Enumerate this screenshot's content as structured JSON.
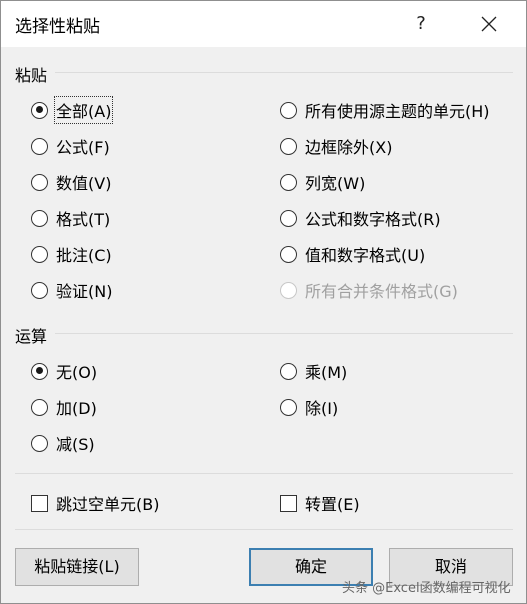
{
  "window": {
    "title": "选择性粘贴",
    "help_label": "?",
    "close_icon": "close-icon"
  },
  "paste": {
    "group_label": "粘贴",
    "options": [
      {
        "label": "全部(A)",
        "checked": true
      },
      {
        "label": "公式(F)",
        "checked": false
      },
      {
        "label": "数值(V)",
        "checked": false
      },
      {
        "label": "格式(T)",
        "checked": false
      },
      {
        "label": "批注(C)",
        "checked": false
      },
      {
        "label": "验证(N)",
        "checked": false
      },
      {
        "label": "所有使用源主题的单元(H)",
        "checked": false
      },
      {
        "label": "边框除外(X)",
        "checked": false
      },
      {
        "label": "列宽(W)",
        "checked": false
      },
      {
        "label": "公式和数字格式(R)",
        "checked": false
      },
      {
        "label": "值和数字格式(U)",
        "checked": false
      },
      {
        "label": "所有合并条件格式(G)",
        "checked": false,
        "disabled": true
      }
    ]
  },
  "operation": {
    "group_label": "运算",
    "options": [
      {
        "label": "无(O)",
        "checked": true
      },
      {
        "label": "加(D)",
        "checked": false
      },
      {
        "label": "减(S)",
        "checked": false
      },
      {
        "label": "乘(M)",
        "checked": false
      },
      {
        "label": "除(I)",
        "checked": false
      }
    ]
  },
  "checks": {
    "skip_blanks": {
      "label": "跳过空单元(B)",
      "checked": false
    },
    "transpose": {
      "label": "转置(E)",
      "checked": false
    }
  },
  "buttons": {
    "paste_link": "粘贴链接(L)",
    "ok": "确定",
    "cancel": "取消"
  },
  "watermark": "头条 @Excel函数编程可视化"
}
